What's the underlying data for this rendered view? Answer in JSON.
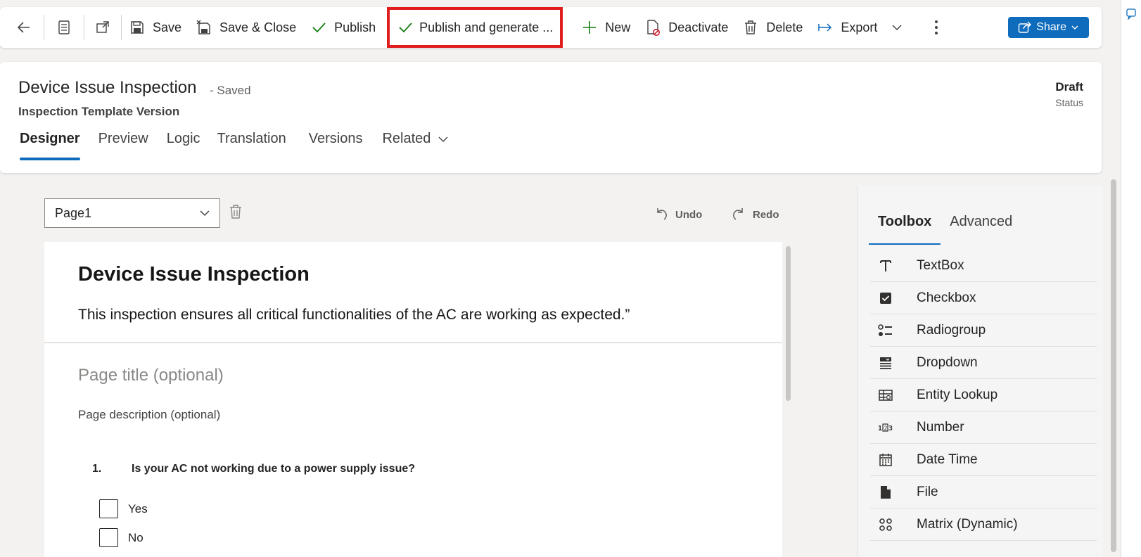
{
  "toolbar": {
    "back_icon": "arrow-left-icon",
    "record_icon": "document-icon",
    "popout_icon": "open-in-new-window-icon",
    "save": "Save",
    "save_close": "Save & Close",
    "publish": "Publish",
    "publish_generate": "Publish and generate ...",
    "new": "New",
    "deactivate": "Deactivate",
    "delete": "Delete",
    "export": "Export",
    "share": "Share",
    "highlight_color": "#e01c1c",
    "share_color": "#0f6cbd"
  },
  "header": {
    "title": "Device Issue Inspection",
    "saved": "- Saved",
    "entity": "Inspection Template Version",
    "status_value": "Draft",
    "status_label": "Status"
  },
  "tabs": [
    {
      "label": "Designer",
      "active": true
    },
    {
      "label": "Preview"
    },
    {
      "label": "Logic"
    },
    {
      "label": "Translation"
    },
    {
      "label": "Versions"
    },
    {
      "label": "Related"
    }
  ],
  "designer": {
    "page_select": "Page1",
    "undo": "Undo",
    "redo": "Redo",
    "form_title": "Device Issue Inspection",
    "form_desc": "This inspection ensures all critical functionalities of the AC are working as expected.”",
    "page_title_placeholder": "Page title (optional)",
    "page_desc_placeholder": "Page description (optional)",
    "question": {
      "number": "1.",
      "text": "Is your AC not working due to a power supply issue?",
      "choices": [
        "Yes",
        "No"
      ]
    }
  },
  "toolbox": {
    "tabs": [
      "Toolbox",
      "Advanced"
    ],
    "items": [
      {
        "label": "TextBox",
        "icon": "text-t-icon"
      },
      {
        "label": "Checkbox",
        "icon": "checkbox-checked-icon"
      },
      {
        "label": "Radiogroup",
        "icon": "radiogroup-icon"
      },
      {
        "label": "Dropdown",
        "icon": "dropdown-icon"
      },
      {
        "label": "Entity Lookup",
        "icon": "table-lookup-icon"
      },
      {
        "label": "Number",
        "icon": "number-icon"
      },
      {
        "label": "Date Time",
        "icon": "calendar-icon"
      },
      {
        "label": "File",
        "icon": "file-icon"
      },
      {
        "label": "Matrix (Dynamic)",
        "icon": "matrix-icon"
      }
    ]
  }
}
